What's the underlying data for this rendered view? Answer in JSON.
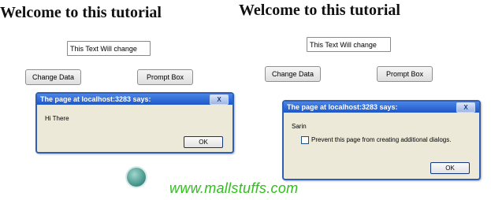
{
  "left": {
    "heading": "Welcome to this tutorial",
    "textbox_value": "This Text Will change",
    "change_data_label": "Change Data",
    "prompt_box_label": "Prompt Box",
    "dialog": {
      "title": "The page at localhost:3283 says:",
      "close": "X",
      "message": "Hi There",
      "ok_label": "OK"
    }
  },
  "right": {
    "heading": "Welcome to this tutorial",
    "textbox_value": "This Text Will change",
    "change_data_label": "Change Data",
    "prompt_box_label": "Prompt Box",
    "dialog": {
      "title": "The page at localhost:3283 says:",
      "close": "X",
      "message": "Sarin",
      "checkbox_label": "Prevent this page from creating additional dialogs.",
      "ok_label": "OK"
    }
  },
  "watermark": "www.mallstuffs.com",
  "colors": {
    "watermark": "#2fbf1b",
    "dialog_title": "#1e56c8",
    "dialog_body": "#ece9d8"
  }
}
